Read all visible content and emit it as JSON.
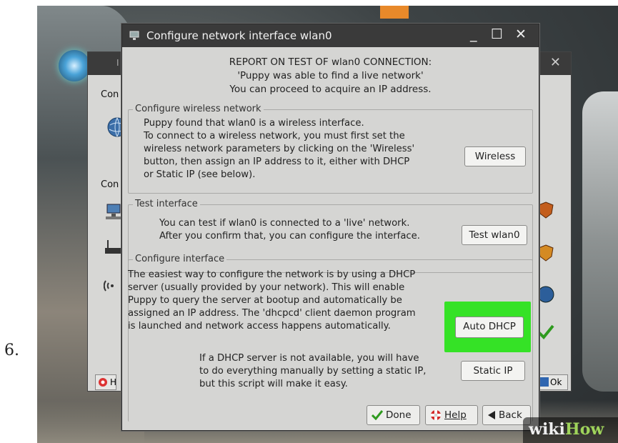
{
  "step_number": "6.",
  "back_window": {
    "labels": [
      "Con",
      "Con"
    ],
    "ok_label": "Ok",
    "help_stub": "H",
    "title_stub": "I"
  },
  "dialog": {
    "title": "Configure network interface wlan0",
    "controls": {
      "minimize": "_",
      "maximize": "☐",
      "close": "✕"
    },
    "report": [
      "REPORT ON TEST OF wlan0 CONNECTION:",
      "'Puppy was able to find a live network'",
      "You can proceed to acquire an IP address."
    ],
    "wireless_section": {
      "title": "Configure wireless network",
      "lines": [
        "Puppy found that wlan0 is a wireless interface.",
        "To connect to a wireless network, you must first set the",
        "wireless network parameters by clicking on the 'Wireless'",
        "button, then assign an IP address to it, either with DHCP",
        "or Static IP (see below)."
      ],
      "button": "Wireless"
    },
    "test_section": {
      "title": "Test interface",
      "lines": [
        "You can test if wlan0 is connected to a 'live' network.",
        "After you confirm that, you can configure the interface."
      ],
      "button": "Test wlan0"
    },
    "configure_section": {
      "title": "Configure interface",
      "lines": [
        "The easiest way to configure the network is by using a DHCP",
        "server (usually provided by your network). This will enable",
        "Puppy to query the server at bootup and automatically be",
        "assigned an IP address. The 'dhcpcd' client daemon program",
        "is launched and network access happens automatically."
      ],
      "dhcp_button": "Auto DHCP",
      "static_lines": [
        "If a DHCP server is not available, you will have",
        "to do everything manually by setting a static IP,",
        "but this script will make it easy."
      ],
      "static_button": "Static IP"
    },
    "footer": {
      "done": "Done",
      "help": "Help",
      "back": "Back"
    }
  },
  "watermark": {
    "wiki": "wiki",
    "how": "How"
  },
  "colors": {
    "highlight": "#35e226",
    "titlebar": "#3a3a3a",
    "dialog_bg": "#d5d5d3",
    "done_check": "#2e9a1e"
  },
  "icons": [
    "network-icon",
    "tool-icon",
    "shield-icon",
    "checkmark-icon",
    "lifebuoy-icon",
    "back-arrow-icon"
  ]
}
